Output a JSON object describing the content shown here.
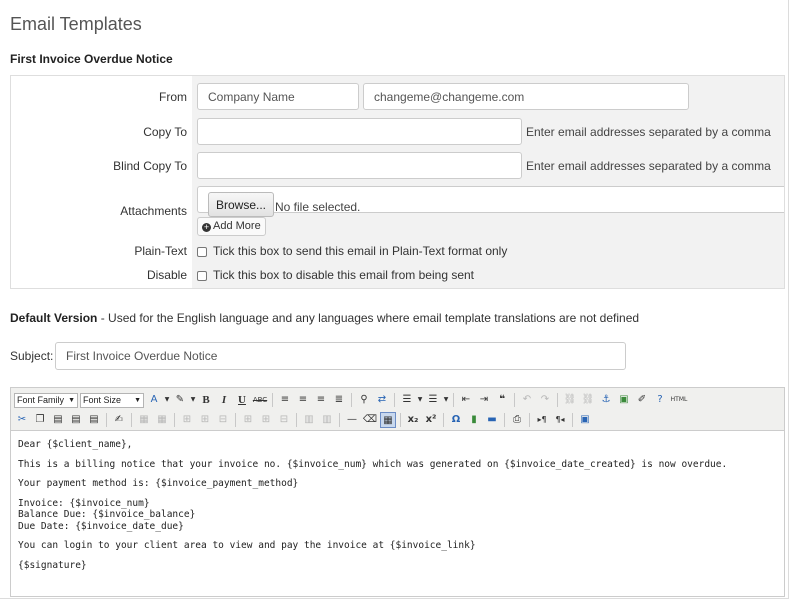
{
  "page_title": "Email Templates",
  "template_name": "First Invoice Overdue Notice",
  "form": {
    "from_label": "From",
    "from_name": "Company Name",
    "from_email": "changeme@changeme.com",
    "copy_to_label": "Copy To",
    "copy_to_value": "",
    "copy_to_hint": "Enter email addresses separated by a comma",
    "bcc_label": "Blind Copy To",
    "bcc_value": "",
    "bcc_hint": "Enter email addresses separated by a comma",
    "attachments_label": "Attachments",
    "browse_label": "Browse...",
    "no_file": "No file selected.",
    "add_more": "Add More",
    "plain_text_label": "Plain-Text",
    "plain_text_desc": "Tick this box to send this email in Plain-Text format only",
    "disable_label": "Disable",
    "disable_desc": "Tick this box to disable this email from being sent"
  },
  "default_version": {
    "title": "Default Version",
    "desc": " - Used for the English language and any languages where email template translations are not defined"
  },
  "subject": {
    "label": "Subject:",
    "value": "First Invoice Overdue Notice"
  },
  "editor": {
    "font_family": "Font Family",
    "font_size": "Font Size",
    "lines": [
      "Dear {$client_name},",
      "",
      "This is a billing notice that your invoice no. {$invoice_num} which was generated on {$invoice_date_created} is now overdue.",
      "",
      "Your payment method is: {$invoice_payment_method}",
      "",
      "Invoice: {$invoice_num}",
      "Balance Due: {$invoice_balance}",
      "Due Date: {$invoice_date_due}",
      "",
      "You can login to your client area to view and pay the invoice at {$invoice_link}",
      "",
      "{$signature}"
    ]
  }
}
